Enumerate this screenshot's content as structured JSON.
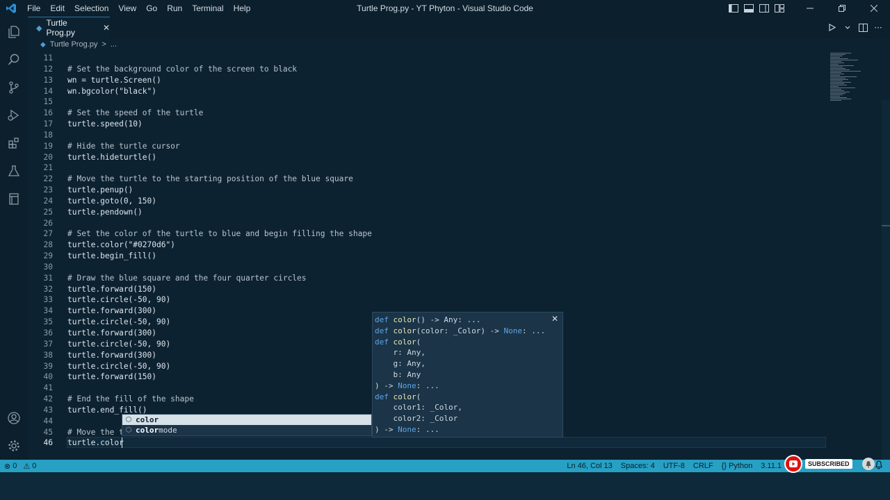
{
  "window": {
    "title": "Turtle Prog.py - YT Phyton - Visual Studio Code"
  },
  "menu": [
    "File",
    "Edit",
    "Selection",
    "View",
    "Go",
    "Run",
    "Terminal",
    "Help"
  ],
  "tab": {
    "label": "Turtle Prog.py",
    "close_glyph": "✕"
  },
  "breadcrumb": {
    "file": "Turtle Prog.py",
    "sep": ">",
    "more": "..."
  },
  "code_lines": [
    {
      "num": "11",
      "text": "",
      "type": "code"
    },
    {
      "num": "12",
      "text": "# Set the background color of the screen to black",
      "type": "comment"
    },
    {
      "num": "13",
      "text": "wn = turtle.Screen()",
      "type": "code"
    },
    {
      "num": "14",
      "text": "wn.bgcolor(\"black\")",
      "type": "code"
    },
    {
      "num": "15",
      "text": "",
      "type": "code"
    },
    {
      "num": "16",
      "text": "# Set the speed of the turtle",
      "type": "comment"
    },
    {
      "num": "17",
      "text": "turtle.speed(10)",
      "type": "code"
    },
    {
      "num": "18",
      "text": "",
      "type": "code"
    },
    {
      "num": "19",
      "text": "# Hide the turtle cursor",
      "type": "comment"
    },
    {
      "num": "20",
      "text": "turtle.hideturtle()",
      "type": "code"
    },
    {
      "num": "21",
      "text": "",
      "type": "code"
    },
    {
      "num": "22",
      "text": "# Move the turtle to the starting position of the blue square",
      "type": "comment"
    },
    {
      "num": "23",
      "text": "turtle.penup()",
      "type": "code"
    },
    {
      "num": "24",
      "text": "turtle.goto(0, 150)",
      "type": "code"
    },
    {
      "num": "25",
      "text": "turtle.pendown()",
      "type": "code"
    },
    {
      "num": "26",
      "text": "",
      "type": "code"
    },
    {
      "num": "27",
      "text": "# Set the color of the turtle to blue and begin filling the shape",
      "type": "comment"
    },
    {
      "num": "28",
      "text": "turtle.color(\"#0270d6\")",
      "type": "code"
    },
    {
      "num": "29",
      "text": "turtle.begin_fill()",
      "type": "code"
    },
    {
      "num": "30",
      "text": "",
      "type": "code"
    },
    {
      "num": "31",
      "text": "# Draw the blue square and the four quarter circles",
      "type": "comment"
    },
    {
      "num": "32",
      "text": "turtle.forward(150)",
      "type": "code"
    },
    {
      "num": "33",
      "text": "turtle.circle(-50, 90)",
      "type": "code"
    },
    {
      "num": "34",
      "text": "turtle.forward(300)",
      "type": "code"
    },
    {
      "num": "35",
      "text": "turtle.circle(-50, 90)",
      "type": "code"
    },
    {
      "num": "36",
      "text": "turtle.forward(300)",
      "type": "code"
    },
    {
      "num": "37",
      "text": "turtle.circle(-50, 90)",
      "type": "code"
    },
    {
      "num": "38",
      "text": "turtle.forward(300)",
      "type": "code"
    },
    {
      "num": "39",
      "text": "turtle.circle(-50, 90)",
      "type": "code"
    },
    {
      "num": "40",
      "text": "turtle.forward(150)",
      "type": "code"
    },
    {
      "num": "41",
      "text": "",
      "type": "code"
    },
    {
      "num": "42",
      "text": "# End the fill of the shape",
      "type": "comment"
    },
    {
      "num": "43",
      "text": "turtle.end_fill()",
      "type": "code"
    },
    {
      "num": "44",
      "text": "",
      "type": "code"
    },
    {
      "num": "45",
      "text": "# Move the t",
      "type": "comment"
    },
    {
      "num": "46",
      "text": "turtle.color",
      "type": "code",
      "current": true
    }
  ],
  "signature_help": {
    "close_glyph": "✕",
    "lines": [
      [
        {
          "t": "def ",
          "c": "kw"
        },
        {
          "t": "color",
          "c": "fn"
        },
        {
          "t": "() -> ",
          "c": "pl"
        },
        {
          "t": "Any",
          "c": "pl"
        },
        {
          "t": ": ...",
          "c": "pl"
        }
      ],
      [
        {
          "t": "def ",
          "c": "kw"
        },
        {
          "t": "color",
          "c": "fn"
        },
        {
          "t": "(color: _Color) -> ",
          "c": "pl"
        },
        {
          "t": "None",
          "c": "kw"
        },
        {
          "t": ": ...",
          "c": "pl"
        }
      ],
      [
        {
          "t": "def ",
          "c": "kw"
        },
        {
          "t": "color",
          "c": "fn"
        },
        {
          "t": "(",
          "c": "pl"
        }
      ],
      [
        {
          "t": "    r: Any,",
          "c": "pl"
        }
      ],
      [
        {
          "t": "    g: Any,",
          "c": "pl"
        }
      ],
      [
        {
          "t": "    b: Any",
          "c": "pl"
        }
      ],
      [
        {
          "t": ") -> ",
          "c": "pl"
        },
        {
          "t": "None",
          "c": "kw"
        },
        {
          "t": ": ...",
          "c": "pl"
        }
      ],
      [
        {
          "t": "def ",
          "c": "kw"
        },
        {
          "t": "color",
          "c": "fn"
        },
        {
          "t": "(",
          "c": "pl"
        }
      ],
      [
        {
          "t": "    color1: _Color,",
          "c": "pl"
        }
      ],
      [
        {
          "t": "    color2: _Color",
          "c": "pl"
        }
      ],
      [
        {
          "t": ") -> ",
          "c": "pl"
        },
        {
          "t": "None",
          "c": "kw"
        },
        {
          "t": ": ...",
          "c": "pl"
        }
      ]
    ]
  },
  "suggestions": [
    {
      "match": "color",
      "rest": "",
      "selected": true
    },
    {
      "match": "color",
      "rest": "mode",
      "selected": false
    }
  ],
  "status": {
    "errors": "0",
    "warnings": "0",
    "position": "Ln 46, Col 13",
    "spaces": "Spaces: 4",
    "encoding": "UTF-8",
    "eol": "CRLF",
    "language": "Python",
    "version": "3.11.1"
  },
  "overlay": {
    "subscribe_label": "SUBSCRIBED"
  },
  "colors": {
    "status_bar": "#27a0c4",
    "editor_bg": "#0d2231",
    "youtube_red": "#e01010"
  }
}
